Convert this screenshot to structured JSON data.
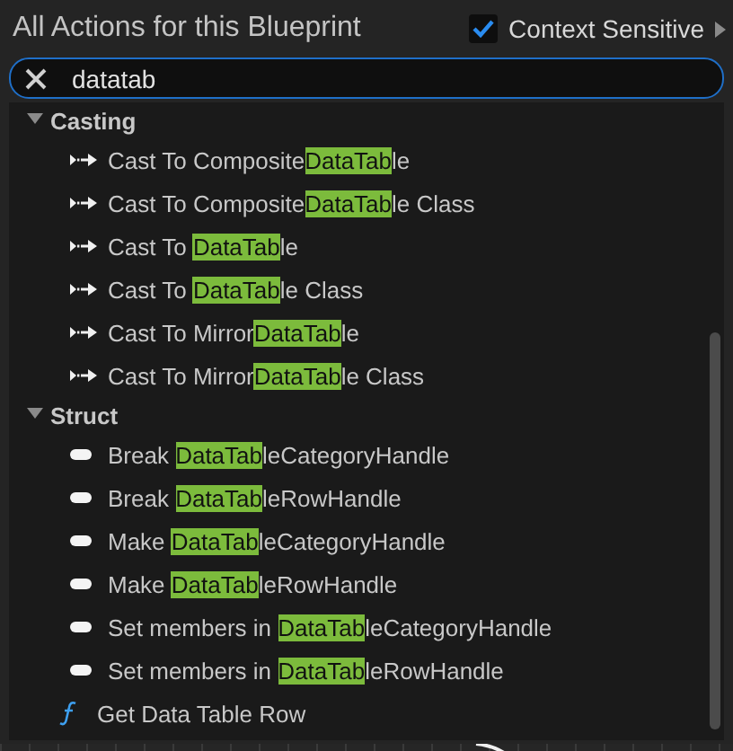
{
  "panel": {
    "title": "All Actions for this Blueprint",
    "context_sensitive": {
      "label": "Context Sensitive",
      "checked": true
    }
  },
  "search": {
    "value": "datatab"
  },
  "tree": [
    {
      "kind": "category",
      "label": "Casting",
      "expanded": true,
      "children": [
        {
          "kind": "cast",
          "label": "Cast To Composite",
          "match": "DataTab",
          "suffix": "le"
        },
        {
          "kind": "cast",
          "label": "Cast To Composite",
          "match": "DataTab",
          "suffix": "le Class"
        },
        {
          "kind": "cast",
          "label": "Cast To ",
          "match": "DataTab",
          "suffix": "le"
        },
        {
          "kind": "cast",
          "label": "Cast To ",
          "match": "DataTab",
          "suffix": "le Class"
        },
        {
          "kind": "cast",
          "label": "Cast To Mirror",
          "match": "DataTab",
          "suffix": "le"
        },
        {
          "kind": "cast",
          "label": "Cast To Mirror",
          "match": "DataTab",
          "suffix": "le Class"
        }
      ]
    },
    {
      "kind": "category",
      "label": "Struct",
      "expanded": true,
      "children": [
        {
          "kind": "struct",
          "label": "Break ",
          "match": "DataTab",
          "suffix": "leCategoryHandle"
        },
        {
          "kind": "struct",
          "label": "Break ",
          "match": "DataTab",
          "suffix": "leRowHandle"
        },
        {
          "kind": "struct",
          "label": "Make ",
          "match": "DataTab",
          "suffix": "leCategoryHandle"
        },
        {
          "kind": "struct",
          "label": "Make ",
          "match": "DataTab",
          "suffix": "leRowHandle"
        },
        {
          "kind": "struct",
          "label": "Set members in ",
          "match": "DataTab",
          "suffix": "leCategoryHandle"
        },
        {
          "kind": "struct",
          "label": "Set members in ",
          "match": "DataTab",
          "suffix": "leRowHandle"
        }
      ]
    },
    {
      "kind": "function",
      "label": "Get Data Table Row"
    }
  ]
}
